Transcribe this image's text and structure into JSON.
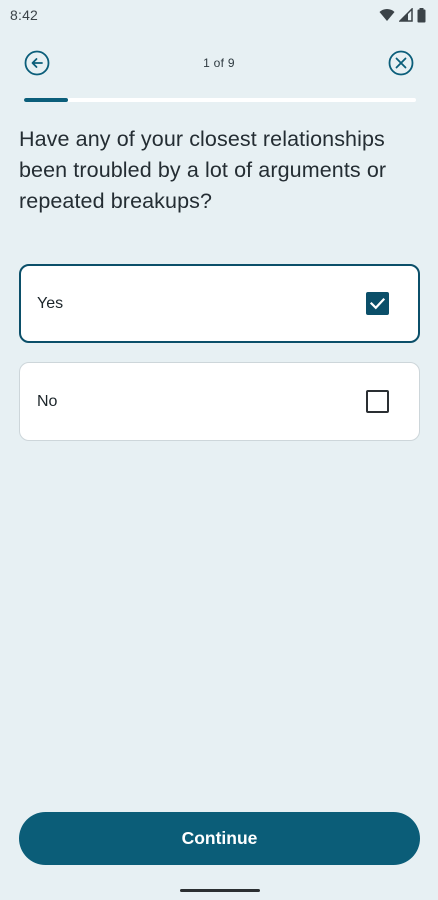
{
  "status_bar": {
    "time": "8:42",
    "icons": [
      "wifi-icon",
      "signal-icon",
      "battery-icon"
    ]
  },
  "nav": {
    "back_icon": "back-arrow-icon",
    "step_indicator": "1 of 9",
    "close_icon": "close-icon"
  },
  "progress": {
    "current": 1,
    "total": 9
  },
  "question": "Have any of your closest relationships been troubled by a lot of arguments or repeated breakups?",
  "options": [
    {
      "label": "Yes",
      "checked": true
    },
    {
      "label": "No",
      "checked": false
    }
  ],
  "continue_label": "Continue",
  "colors": {
    "background": "#e7f0f3",
    "accent": "#0b5e7a",
    "selected_border": "#0b4f69"
  }
}
